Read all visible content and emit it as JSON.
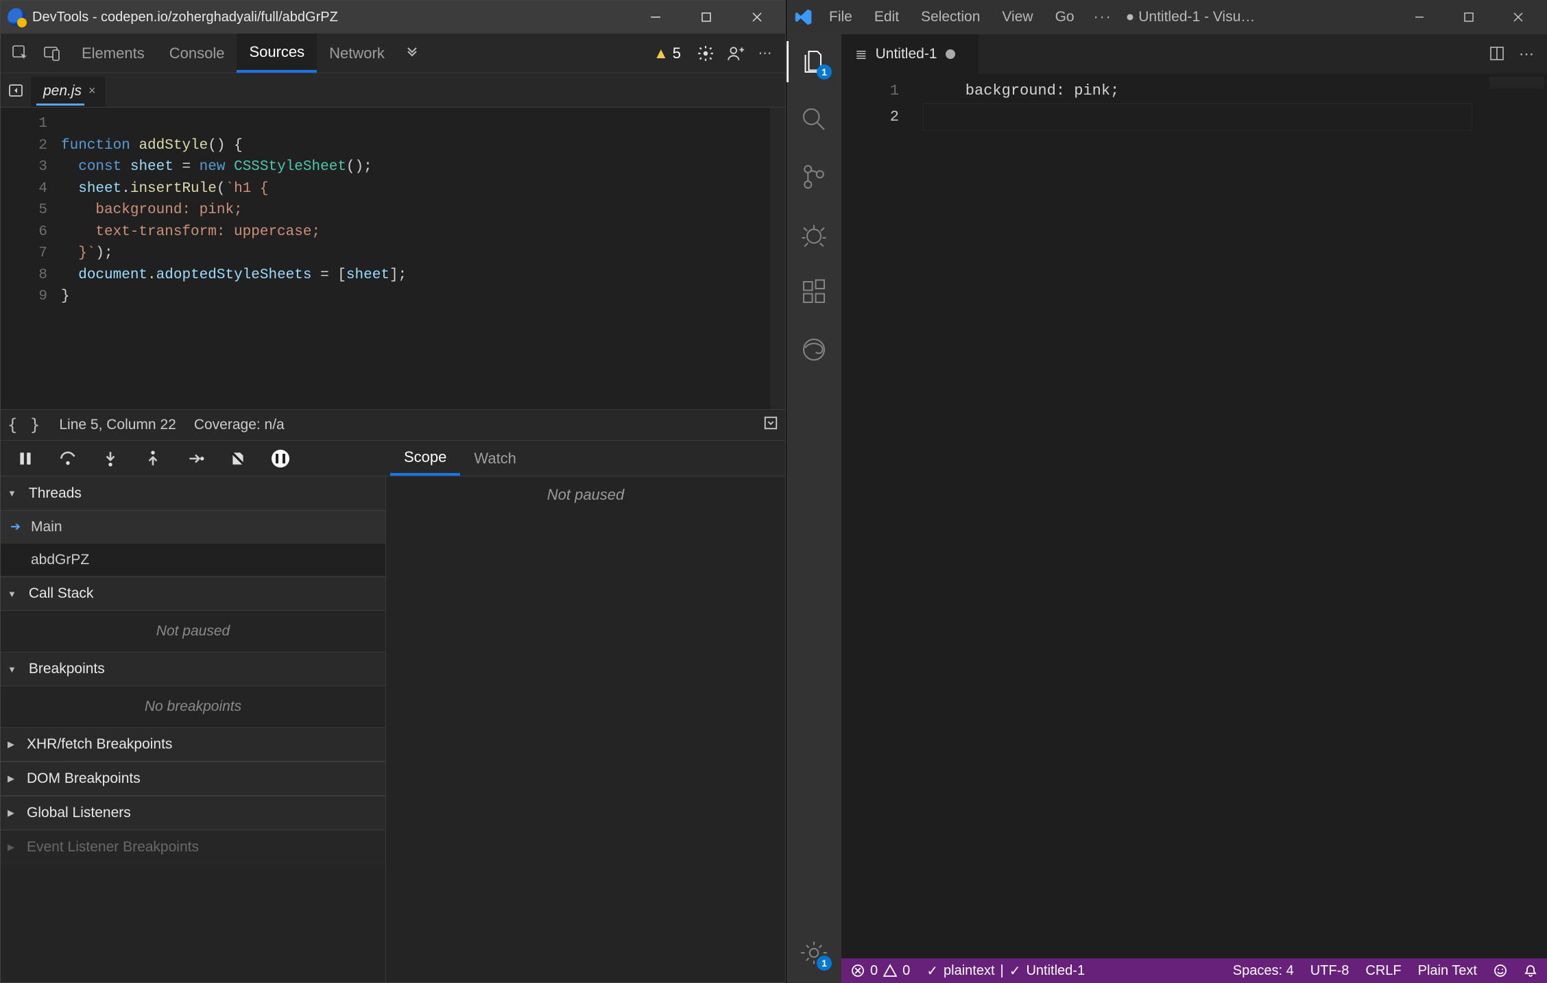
{
  "devtools": {
    "titlebar": {
      "title": "DevTools - codepen.io/zoherghadyali/full/abdGrPZ"
    },
    "toolbar": {
      "tabs": {
        "elements": "Elements",
        "console": "Console",
        "sources": "Sources",
        "network": "Network"
      },
      "warn_count": "5"
    },
    "filebar": {
      "filename": "pen.js"
    },
    "code": {
      "lines": [
        "1",
        "2",
        "3",
        "4",
        "5",
        "6",
        "7",
        "8",
        "9"
      ]
    },
    "statusline": {
      "pos": "Line 5, Column 22",
      "coverage": "Coverage: n/a"
    },
    "scope_tabs": {
      "scope": "Scope",
      "watch": "Watch"
    },
    "scope_panel": {
      "not_paused": "Not paused"
    },
    "panels": {
      "threads": {
        "label": "Threads",
        "main": "Main",
        "other": "abdGrPZ"
      },
      "callstack": {
        "label": "Call Stack",
        "empty": "Not paused"
      },
      "breakpoints": {
        "label": "Breakpoints",
        "empty": "No breakpoints"
      },
      "xhr": {
        "label": "XHR/fetch Breakpoints"
      },
      "dom": {
        "label": "DOM Breakpoints"
      },
      "global": {
        "label": "Global Listeners"
      },
      "evt": {
        "label": "Event Listener Breakpoints"
      }
    }
  },
  "vscode": {
    "menubar": {
      "file": "File",
      "edit": "Edit",
      "selection": "Selection",
      "view": "View",
      "go": "Go",
      "more": "···",
      "title": "Untitled-1 - Visu…",
      "mod": "●"
    },
    "activity": {
      "explorer_badge": "1",
      "settings_badge": "1"
    },
    "tab": {
      "name": "Untitled-1"
    },
    "editor": {
      "lines": {
        "l1": "1",
        "l2": "2"
      },
      "content": {
        "l1": "    background: pink;"
      }
    },
    "statusbar": {
      "errors": "0",
      "warnings": "0",
      "lang_hint": "plaintext",
      "check": "✓",
      "file": "Untitled-1",
      "spaces": "Spaces: 4",
      "enc": "UTF-8",
      "eol": "CRLF",
      "mode": "Plain Text"
    }
  }
}
